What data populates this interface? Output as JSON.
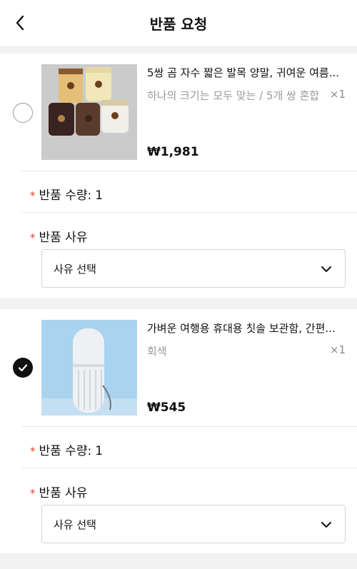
{
  "header": {
    "title": "반품 요청",
    "back_icon": "chevron-left-icon"
  },
  "required_mark": "*",
  "items": [
    {
      "selected": false,
      "name": "5쌍 곰 자수 짧은 발목 양말, 귀여운 여름...",
      "option": "하나의 크기는 모두 맞는 / 5개 쌍 혼합",
      "quantity": "×1",
      "price": "₩1,981",
      "return_qty_label": "반품 수량:",
      "return_qty_value": "1",
      "reason_label": "반품 사유",
      "reason_select": "사유 선택"
    },
    {
      "selected": true,
      "name": "가벼운 여행용 휴대용 칫솔 보관함, 간편...",
      "option": "회색",
      "quantity": "×1",
      "price": "₩545",
      "return_qty_label": "반품 수량:",
      "return_qty_value": "1",
      "reason_label": "반품 사유",
      "reason_select": "사유 선택"
    }
  ],
  "colors": {
    "required": "#e0452f",
    "muted": "#9a9a9a",
    "checked": "#111111"
  }
}
